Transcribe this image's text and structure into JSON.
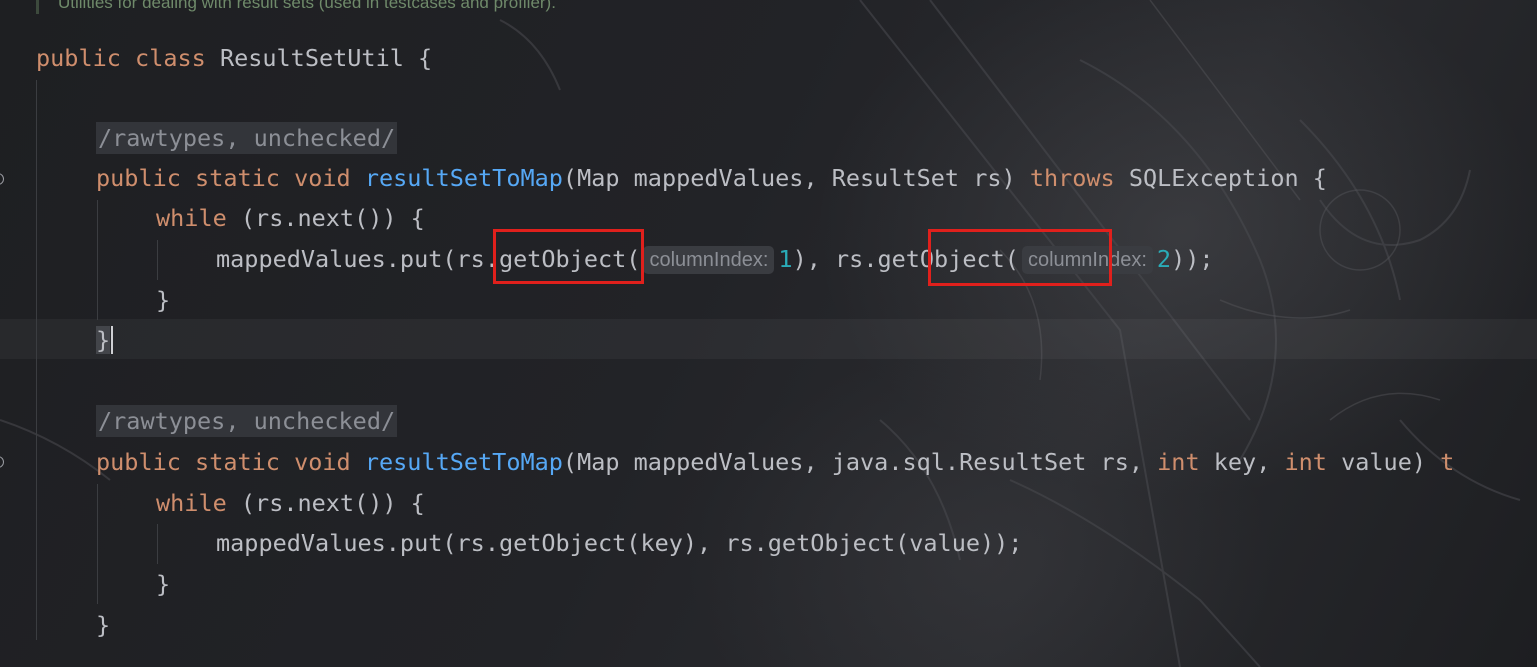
{
  "editor": {
    "doc_comment": "Utilities for dealing with result sets (used in testcases and profiler).",
    "lines": {
      "class_decl": {
        "kw_public": "public",
        "kw_class": "class",
        "name": " ResultSetUtil {"
      },
      "annot1": "/rawtypes, unchecked/",
      "method1": {
        "kw_public": "public",
        "kw_static": "static",
        "kw_void": "void",
        "name": "resultSetToMap",
        "params": "(Map mappedValues, ResultSet rs) ",
        "kw_throws": "throws",
        "tail": " SQLException {"
      },
      "while1": {
        "kw": "while",
        "rest": " (rs.next()) {"
      },
      "put1": {
        "start": "mappedValues.put(rs.getObject(",
        "hint1": "columnIndex:",
        "num1": "1",
        "mid": "), rs.getObject(",
        "hint2": "columnIndex:",
        "num2": "2",
        "end": "));"
      },
      "close_while1": "}",
      "close_method1": "}",
      "annot2": "/rawtypes, unchecked/",
      "method2": {
        "kw_public": "public",
        "kw_static": "static",
        "kw_void": "void",
        "name": "resultSetToMap",
        "params_a": "(Map mappedValues, java.sql.ResultSet rs, ",
        "kw_int1": "int",
        "params_b": " key, ",
        "kw_int2": "int",
        "params_c": " value) ",
        "kw_t": "t"
      },
      "while2": {
        "kw": "while",
        "rest": " (rs.next()) {"
      },
      "put2": "mappedValues.put(rs.getObject(key), rs.getObject(value));",
      "close_while2": "}",
      "close_method2": "}"
    }
  },
  "colors": {
    "keyword": "#cf8e6d",
    "method": "#56a8f5",
    "number": "#2aacb8",
    "text": "#bcbec4",
    "highlight_box": "#e0201c"
  }
}
